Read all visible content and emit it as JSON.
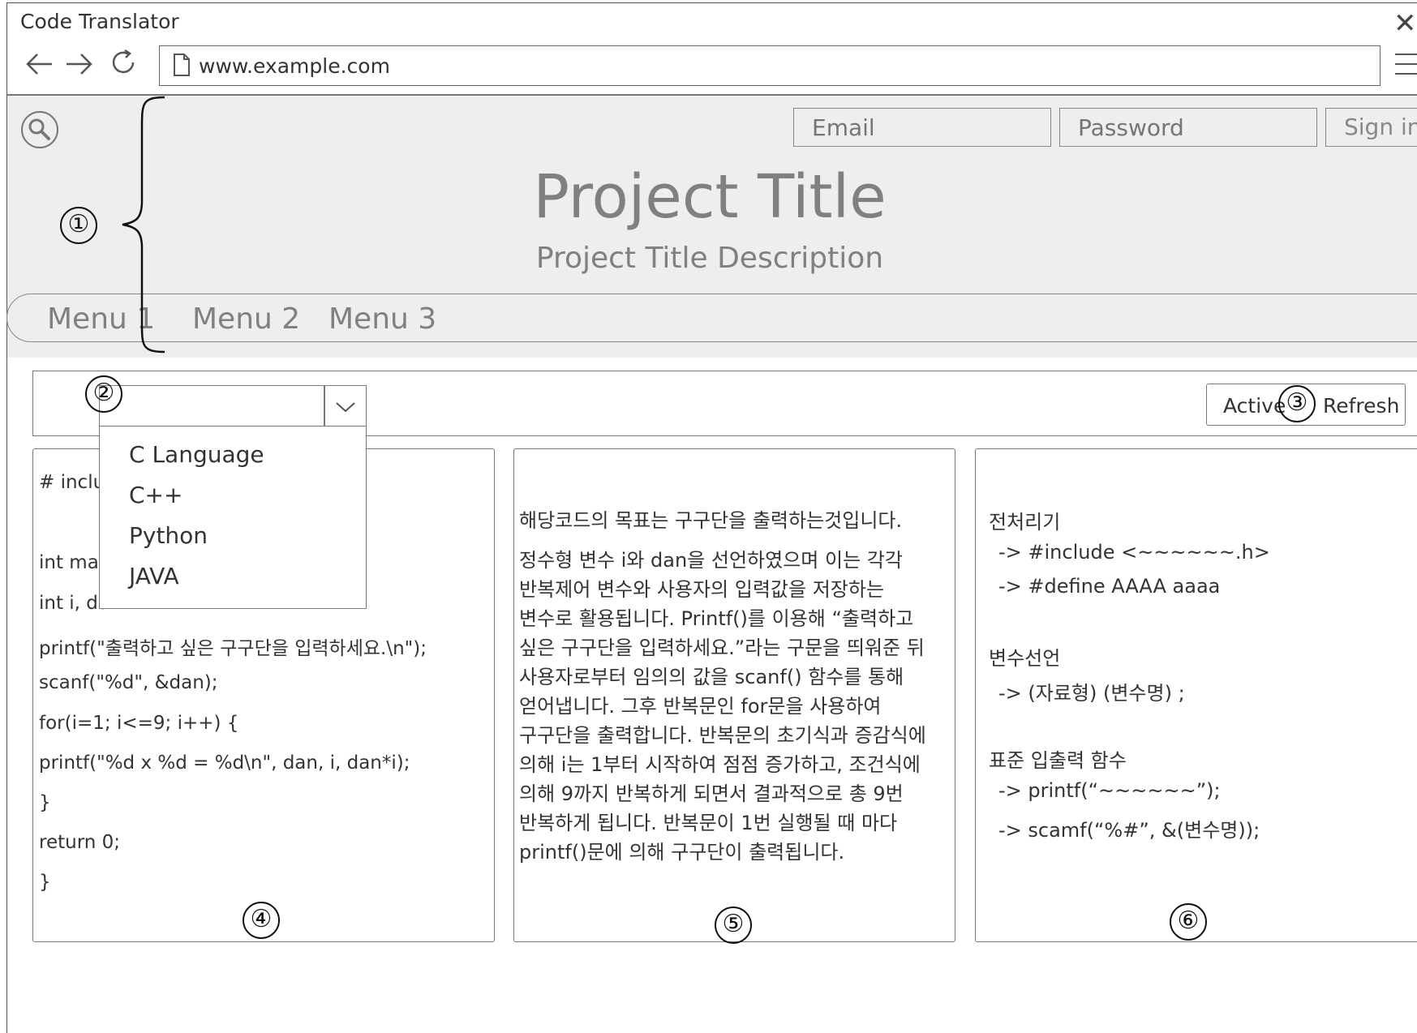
{
  "window": {
    "title": "Code Translator",
    "url": "www.example.com",
    "icons": [
      "back-arrow-icon",
      "forward-arrow-icon",
      "reload-icon",
      "document-icon",
      "hamburger-menu-icon",
      "close-icon"
    ]
  },
  "header": {
    "email_placeholder": "Email",
    "password_placeholder": "Password",
    "sign_in_label": "Sign in",
    "title": "Project Title",
    "description": "Project Title Description",
    "menu": [
      "Menu 1",
      "Menu 2",
      "Menu 3"
    ]
  },
  "toolbar": {
    "language_options": [
      "C Language",
      "C++",
      "Python",
      "JAVA"
    ],
    "active_label": "Active",
    "refresh_label": "Refresh"
  },
  "code_panel": {
    "lines": [
      "# inclu",
      "int mai",
      "int i, da",
      "printf(\"출력하고 싶은 구구단을 입력하세요.\\n\");",
      "scanf(\"%d\", &dan);",
      "for(i=1; i<=9; i++) {",
      "printf(\"%d x %d = %d\\n\", dan, i, dan*i);",
      "}",
      "return 0;",
      "}"
    ]
  },
  "description_panel": {
    "intro": "해당코드의 목표는 구구단을 출력하는것입니다.",
    "lines": [
      "정수형 변수 i와 dan을 선언하였으며 이는 각각",
      "반복제어 변수와 사용자의 입력값을 저장하는",
      "변수로 활용됩니다. Printf()를 이용해 “출력하고",
      "싶은 구구단을 입력하세요.”라는 구문을 띄워준 뒤",
      "사용자로부터 임의의 값을 scanf() 함수를 통해",
      "얻어냅니다. 그후 반복문인 for문을 사용하여",
      "구구단을 출력합니다. 반복문의 초기식과 증감식에",
      "의해 i는 1부터 시작하여 점점 증가하고, 조건식에",
      "의해 9까지 반복하게 되면서 결과적으로 총 9번",
      "반복하게 됩니다. 반복문이 1번 실행될 때 마다",
      "printf()문에 의해 구구단이 출력됩니다."
    ]
  },
  "reference_panel": {
    "sections": [
      {
        "heading": "전처리기",
        "items": [
          "-> #include <~~~~~~.h>",
          "-> #define AAAA aaaa"
        ]
      },
      {
        "heading": "변수선언",
        "items": [
          "-> (자료형) (변수명) ;"
        ]
      },
      {
        "heading": "표준 입출력 함수",
        "items": [
          "-> printf(“~~~~~~”);",
          "-> scamf(“%#”, &(변수명));"
        ]
      }
    ]
  },
  "annotations": [
    "①",
    "②",
    "③",
    "④",
    "⑤",
    "⑥"
  ]
}
